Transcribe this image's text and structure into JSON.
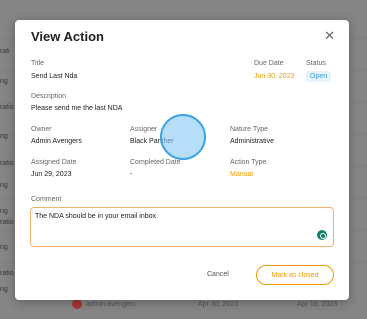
{
  "background": {
    "left_snips": [
      "rati",
      "ng",
      "ratio",
      "ng",
      "ratio",
      "ng",
      "ng",
      "ratio",
      "ng",
      "ratio",
      "ng"
    ],
    "bottom_row": {
      "name": "admin avengers",
      "date1": "Apr 30, 2023",
      "date2": "Apr 16, 2023"
    }
  },
  "modal": {
    "title": "View Action",
    "fields": {
      "title_label": "Title",
      "title_value": "Send Last Nda",
      "due_label": "Due Date",
      "due_value": "Jun 30, 2023",
      "status_label": "Status",
      "status_value": "Open",
      "desc_label": "Description",
      "desc_value": "Please send me the last NDA",
      "owner_label": "Owner",
      "owner_value": "Admin Avengers",
      "assigner_label": "Assigner",
      "assigner_value": "Black Panther",
      "nature_label": "Nature Type",
      "nature_value": "Administrative",
      "assigned_label": "Assigned Date",
      "assigned_value": "Jun 29, 2023",
      "completed_label": "Completed Date",
      "completed_value": "-",
      "action_type_label": "Action Type",
      "action_type_value": "Manual",
      "comment_label": "Comment",
      "comment_value": "The NDA should be in your email inbox."
    },
    "buttons": {
      "cancel": "Cancel",
      "mark_closed": "Mark as closed"
    }
  },
  "colors": {
    "accent": "#f39a00",
    "status": "#3ba1d9",
    "grammar": "#11806d"
  },
  "icons": {
    "close": "close-icon",
    "grammar": "grammar-check-icon"
  }
}
